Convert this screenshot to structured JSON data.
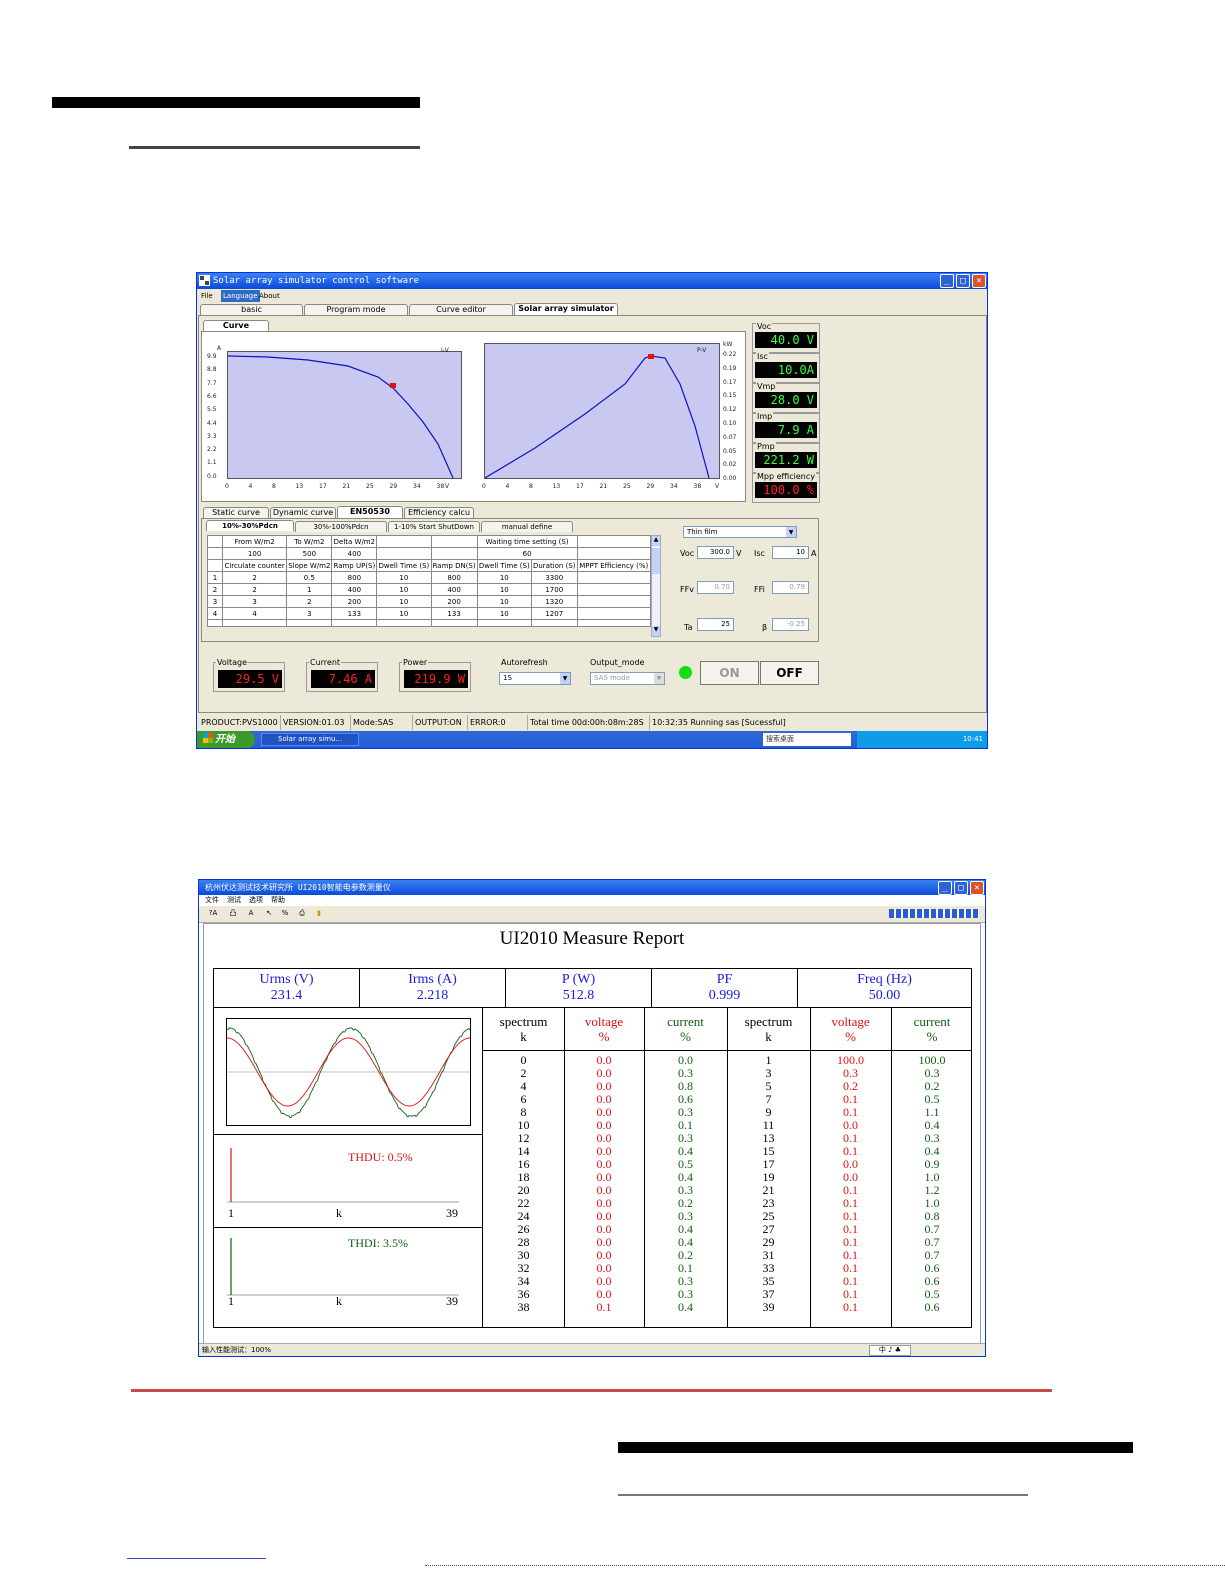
{
  "window1": {
    "title": "Solar array simulator control software",
    "menu": [
      "File",
      "Language",
      "About"
    ],
    "main_tabs": [
      "basic",
      "Program mode",
      "Curve editor",
      "Solar array simulator"
    ],
    "curve_tab": "Curve",
    "iv_chart": {
      "tag": "I-V",
      "unit_y": "A",
      "unit_x": "V",
      "y_ticks": [
        "9.9",
        "8.8",
        "7.7",
        "6.6",
        "5.5",
        "4.4",
        "3.3",
        "2.2",
        "1.1",
        "0.0"
      ],
      "x_ticks": [
        "0",
        "4",
        "8",
        "13",
        "17",
        "21",
        "25",
        "29",
        "34",
        "38"
      ]
    },
    "pv_chart": {
      "tag": "P-V",
      "unit_y": "kW",
      "unit_x": "V",
      "y_ticks": [
        "0.22",
        "0.19",
        "0.17",
        "0.15",
        "0.12",
        "0.10",
        "0.07",
        "0.05",
        "0.02",
        "0.00"
      ],
      "x_ticks": [
        "0",
        "4",
        "8",
        "13",
        "17",
        "21",
        "25",
        "29",
        "34",
        "38"
      ]
    },
    "readouts": [
      {
        "label": "Voc",
        "value": "40.0 V"
      },
      {
        "label": "Isc",
        "value": "10.0A"
      },
      {
        "label": "Vmp",
        "value": "28.0 V"
      },
      {
        "label": "Imp",
        "value": "7.9 A"
      },
      {
        "label": "Pmp",
        "value": "221.2 W"
      },
      {
        "label": "Mpp efficiency",
        "value": "100.0 %"
      }
    ],
    "sub_tabs": [
      "Static curve",
      "Dynamic curve",
      "EN50530",
      "Efficiency calcu"
    ],
    "inner_tabs": [
      "10%-30%Pdcn",
      "30%-100%Pdcn",
      "1-10% Start ShutDown",
      "manual define"
    ],
    "table": {
      "h1": [
        "From W/m2",
        "To W/m2",
        "Delta W/m2",
        "",
        "",
        "Waiting time setting (S)"
      ],
      "v1": [
        "100",
        "500",
        "400",
        "",
        "",
        "60"
      ],
      "h2": [
        "Circulate counter",
        "Slope W/m2",
        "Ramp UP(S)",
        "Dwell Time (S)",
        "Ramp DN(S)",
        "Dwell Time (S)",
        "Duration (S)",
        "MPPT Efficiency (%)"
      ],
      "rows": [
        [
          "1",
          "2",
          "0.5",
          "800",
          "10",
          "800",
          "10",
          "3300",
          ""
        ],
        [
          "2",
          "2",
          "1",
          "400",
          "10",
          "400",
          "10",
          "1700",
          ""
        ],
        [
          "3",
          "3",
          "2",
          "200",
          "10",
          "200",
          "10",
          "1320",
          ""
        ],
        [
          "4",
          "4",
          "3",
          "133",
          "10",
          "133",
          "10",
          "1207",
          ""
        ]
      ]
    },
    "params": {
      "type": "Thin film",
      "voc_label": "Voc",
      "voc": "300.0",
      "voc_unit": "V",
      "isc_label": "Isc",
      "isc": "10",
      "isc_unit": "A",
      "ffv_label": "FFv",
      "ffv": "0.70",
      "ffi_label": "FFi",
      "ffi": "0.79",
      "ta_label": "Ta",
      "ta": "25",
      "beta_label": "β",
      "beta": "-0.25"
    },
    "meas": [
      {
        "label": "Voltage",
        "value": "29.5 V"
      },
      {
        "label": "Current",
        "value": "7.46 A"
      },
      {
        "label": "Power",
        "value": "219.9 W"
      }
    ],
    "autorefresh_label": "Autorefresh",
    "autorefresh_value": "1S",
    "output_mode_label": "Output_mode",
    "output_mode_value": "SAS mode",
    "on_label": "ON",
    "off_label": "OFF",
    "status": [
      "PRODUCT:PVS1000",
      "VERSION:01.03",
      "Mode:SAS",
      "OUTPUT:ON",
      "ERROR:0",
      "Total time 00d:00h:08m:28S",
      "10:32:35 Running sas [Sucessful]"
    ],
    "taskbar": {
      "start": "开始",
      "item": "Solar array simu...",
      "search": "搜索桌面",
      "clock": "10:41"
    }
  },
  "window2": {
    "title": "杭州伏达测试技术研究所  UI2010智能电参数测量仪",
    "menu": [
      "文件",
      "测试",
      "选项",
      "帮助"
    ],
    "toolbar": [
      "?A",
      "凸",
      "A",
      "↖",
      "%",
      "⎙",
      "▮"
    ],
    "report_title": "UI2010 Measure Report",
    "headers": [
      {
        "label": "Urms (V)",
        "value": "231.4"
      },
      {
        "label": "Irms (A)",
        "value": "2.218"
      },
      {
        "label": "P (W)",
        "value": "512.8"
      },
      {
        "label": "PF",
        "value": "0.999"
      },
      {
        "label": "Freq (Hz)",
        "value": "50.00"
      }
    ],
    "thdu": "THDU:  0.5%",
    "thdi": "THDI:  3.5%",
    "axis_start": "1",
    "axis_mid": "k",
    "axis_end": "39",
    "spectrum_head": {
      "spectrum": "spectrum",
      "k": "k",
      "voltage": "voltage",
      "current": "current",
      "pct": "%"
    },
    "spectrum_left": {
      "k": [
        "0",
        "2",
        "4",
        "6",
        "8",
        "10",
        "12",
        "14",
        "16",
        "18",
        "20",
        "22",
        "24",
        "26",
        "28",
        "30",
        "32",
        "34",
        "36",
        "38"
      ],
      "voltage": [
        "0.0",
        "0.0",
        "0.0",
        "0.0",
        "0.0",
        "0.0",
        "0.0",
        "0.0",
        "0.0",
        "0.0",
        "0.0",
        "0.0",
        "0.0",
        "0.0",
        "0.0",
        "0.0",
        "0.0",
        "0.0",
        "0.0",
        "0.1"
      ],
      "current": [
        "0.0",
        "0.3",
        "0.8",
        "0.6",
        "0.3",
        "0.1",
        "0.3",
        "0.4",
        "0.5",
        "0.4",
        "0.3",
        "0.2",
        "0.3",
        "0.4",
        "0.4",
        "0.2",
        "0.1",
        "0.3",
        "0.3",
        "0.4"
      ]
    },
    "spectrum_right": {
      "k": [
        "1",
        "3",
        "5",
        "7",
        "9",
        "11",
        "13",
        "15",
        "17",
        "19",
        "21",
        "23",
        "25",
        "27",
        "29",
        "31",
        "33",
        "35",
        "37",
        "39"
      ],
      "voltage": [
        "100.0",
        "0.3",
        "0.2",
        "0.1",
        "0.1",
        "0.0",
        "0.1",
        "0.1",
        "0.0",
        "0.0",
        "0.1",
        "0.1",
        "0.1",
        "0.1",
        "0.1",
        "0.1",
        "0.1",
        "0.1",
        "0.1",
        "0.1"
      ],
      "current": [
        "100.0",
        "0.3",
        "0.2",
        "0.5",
        "1.1",
        "0.4",
        "0.3",
        "0.4",
        "0.9",
        "1.0",
        "1.2",
        "1.0",
        "0.8",
        "0.7",
        "0.7",
        "0.7",
        "0.6",
        "0.6",
        "0.5",
        "0.6"
      ]
    },
    "status": "输入性能测试：100%",
    "status_right": "中 ♪ ♣"
  }
}
